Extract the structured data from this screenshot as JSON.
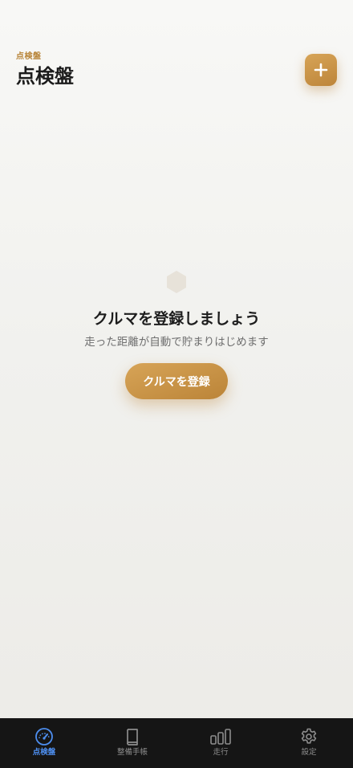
{
  "header": {
    "eyebrow": "点検盤",
    "title": "点検盤",
    "add_button_icon": "plus-icon"
  },
  "empty_state": {
    "icon": "hexagon-icon",
    "title": "クルマを登録しましょう",
    "subtitle": "走った距離が自動で貯まりはじめます",
    "button_label": "クルマを登録"
  },
  "tabbar": {
    "items": [
      {
        "label": "点検盤",
        "icon": "speedometer-icon",
        "active": true
      },
      {
        "label": "整備手帳",
        "icon": "book-icon",
        "active": false
      },
      {
        "label": "走行",
        "icon": "bar-chart-icon",
        "active": false
      },
      {
        "label": "設定",
        "icon": "gear-icon",
        "active": false
      }
    ]
  },
  "colors": {
    "accent": "#c9924a",
    "tab_active": "#4d8eef",
    "tab_inactive": "#8d8d8d",
    "tabbar_bg": "#151515"
  }
}
